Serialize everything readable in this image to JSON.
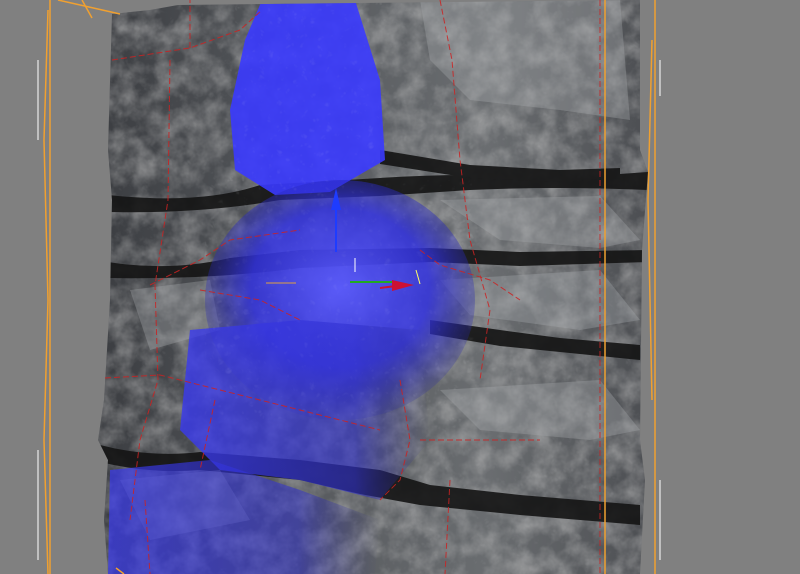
{
  "viewport": {
    "background_color": "#808080",
    "selection_color": "#f0a030",
    "seam_color": "#cc2222",
    "paint_color": "#3535ff"
  },
  "gizmo": {
    "z_axis_color": "#1e3cff",
    "x_axis_color": "#cc1133",
    "y_axis_color": "#22aa22"
  }
}
